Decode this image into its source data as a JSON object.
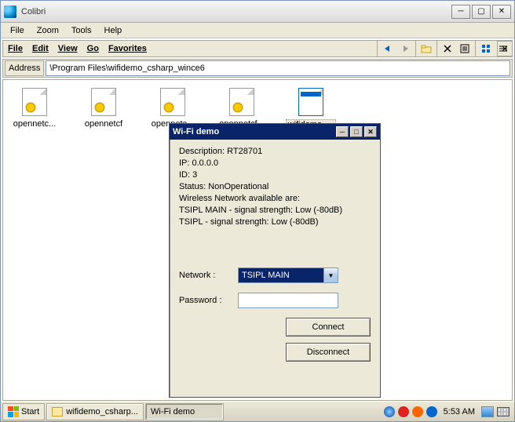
{
  "outer": {
    "title": "Colibri",
    "menu": [
      "File",
      "Zoom",
      "Tools",
      "Help"
    ]
  },
  "explorer": {
    "menubar": [
      "File",
      "Edit",
      "View",
      "Go",
      "Favorites"
    ],
    "address_label": "Address",
    "address_value": "\\Program Files\\wifidemo_csharp_wince6",
    "files": [
      {
        "label": "opennetc...",
        "type": "gear"
      },
      {
        "label": "opennetcf",
        "type": "gear"
      },
      {
        "label": "opennetc...",
        "type": "gear"
      },
      {
        "label": "opennetcf...",
        "type": "gear"
      },
      {
        "label": "wifidemo_...",
        "type": "app",
        "selected": true
      }
    ]
  },
  "wifi": {
    "title": "Wi-Fi demo",
    "lines": [
      "Description: RT28701",
      "IP: 0.0.0.0",
      "ID: 3",
      "Status: NonOperational",
      "Wireless Network available are:",
      "TSIPL MAIN -  signal strength: Low (-80dB)",
      "TSIPL -  signal strength: Low (-80dB)"
    ],
    "network_label": "Network  :",
    "network_value": "TSIPL MAIN",
    "password_label": "Password  :",
    "password_value": "",
    "connect": "Connect",
    "disconnect": "Disconnect"
  },
  "taskbar": {
    "start": "Start",
    "items": [
      {
        "label": "wifidemo_csharp...",
        "icon": "folder"
      },
      {
        "label": "Wi-Fi demo",
        "icon": "none",
        "active": true
      }
    ],
    "clock": "5:53 AM"
  }
}
